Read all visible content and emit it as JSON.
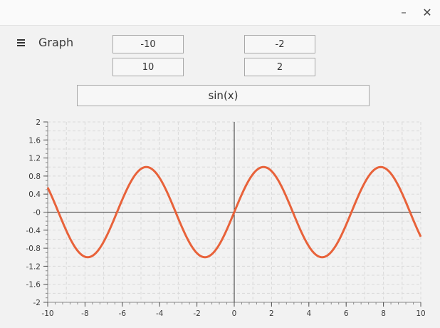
{
  "window": {
    "minimize_glyph": "–",
    "close_glyph": "✕"
  },
  "header": {
    "menu_icon": "hamburger-menu-icon",
    "title": "Graph"
  },
  "inputs": {
    "x_min": "-10",
    "x_max": "10",
    "y_min": "-2",
    "y_max": "2",
    "function": "sin(x)"
  },
  "chart_data": {
    "type": "line",
    "title": "",
    "xlabel": "",
    "ylabel": "",
    "function": "sin(x)",
    "xlim": [
      -10,
      10
    ],
    "ylim": [
      -2,
      2
    ],
    "x_ticks": [
      "-10",
      "-8",
      "-6",
      "-4",
      "-2",
      "0",
      "2",
      "4",
      "6",
      "8",
      "10"
    ],
    "y_ticks": [
      "2",
      "1.6",
      "1.2",
      "0.8",
      "0.4",
      "-0",
      "-0.4",
      "-0.8",
      "-1.2",
      "-1.6",
      "-2"
    ],
    "grid": true,
    "series": [
      {
        "x": [
          -10,
          -9.5,
          -9,
          -8.5,
          -8,
          -7.5,
          -7,
          -6.5,
          -6,
          -5.5,
          -5,
          -4.5,
          -4,
          -3.5,
          -3,
          -2.5,
          -2,
          -1.5,
          -1,
          -0.5,
          0,
          0.5,
          1,
          1.5,
          2,
          2.5,
          3,
          3.5,
          4,
          4.5,
          5,
          5.5,
          6,
          6.5,
          7,
          7.5,
          8,
          8.5,
          9,
          9.5,
          10
        ],
        "y": [
          0.544,
          0.075,
          -0.412,
          -0.798,
          -0.989,
          -0.938,
          -0.657,
          -0.215,
          0.279,
          0.706,
          0.959,
          0.978,
          0.757,
          0.351,
          -0.141,
          -0.598,
          -0.909,
          -0.997,
          -0.841,
          -0.479,
          0,
          0.479,
          0.841,
          0.997,
          0.909,
          0.598,
          0.141,
          -0.351,
          -0.757,
          -0.978,
          -0.959,
          -0.706,
          -0.279,
          0.215,
          0.657,
          0.938,
          0.989,
          0.798,
          0.412,
          -0.075,
          -0.544
        ]
      }
    ],
    "colors": {
      "curve": "#e8623a",
      "axis": "#333333",
      "grid": "#d9d9d9"
    }
  }
}
